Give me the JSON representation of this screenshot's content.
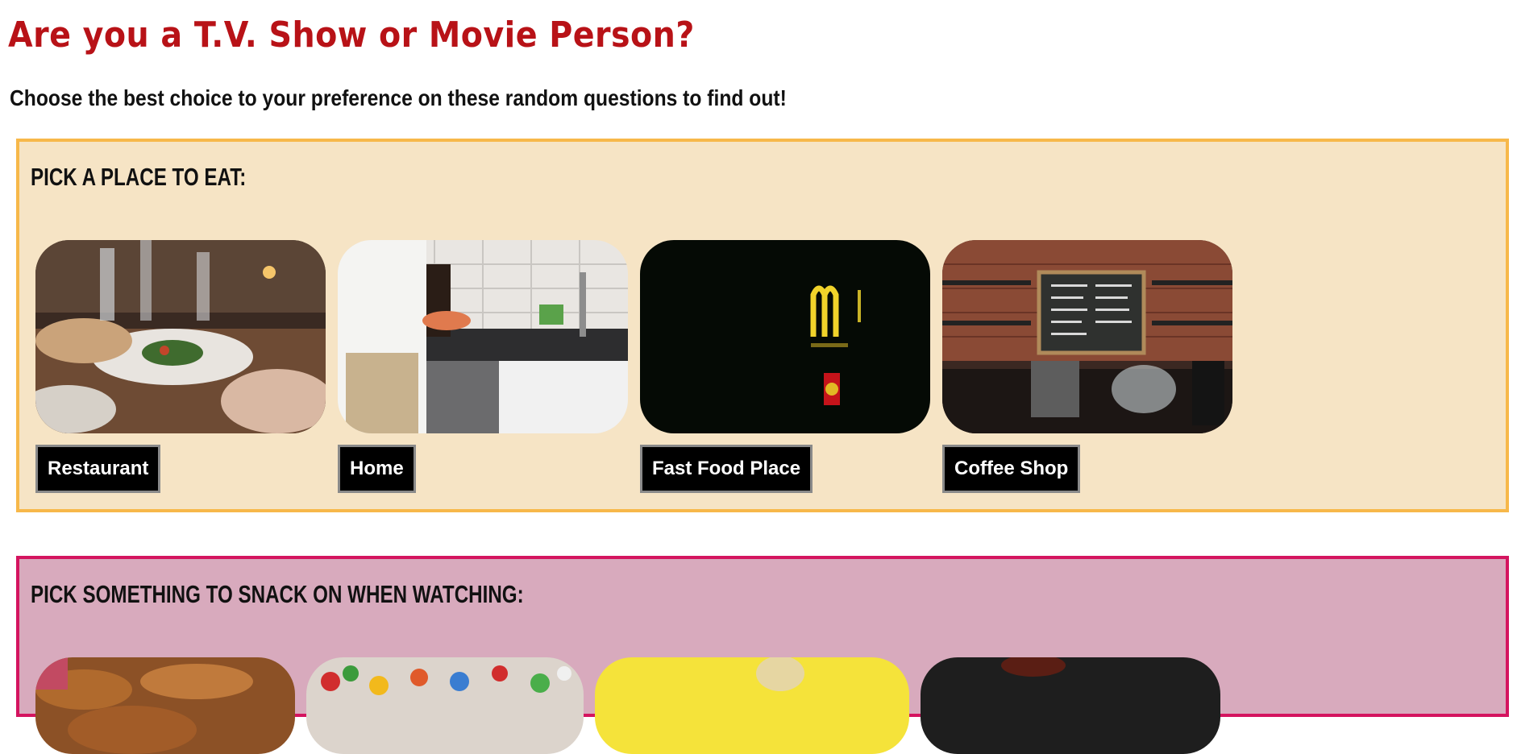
{
  "page": {
    "title": "Are you a T.V. Show or Movie Person?",
    "subtitle": "Choose the best choice to your preference on these random questions to find out!"
  },
  "colors": {
    "title": "#b81217",
    "q1_border": "#f7b84a",
    "q1_background": "#f6e4c5",
    "q2_border": "#d4145f",
    "q2_background": "#d8aabd",
    "button_background": "#000000",
    "button_text": "#ffffff"
  },
  "questions": [
    {
      "heading": "Pick a place to eat:",
      "options": [
        {
          "label": "Restaurant",
          "image": "restaurant-dining-table-photo"
        },
        {
          "label": "Home",
          "image": "home-kitchen-cooking-photo"
        },
        {
          "label": "Fast Food Place",
          "image": "mcdonalds-sign-at-night-photo"
        },
        {
          "label": "Coffee Shop",
          "image": "coffee-shop-counter-photo"
        }
      ]
    },
    {
      "heading": "Pick something to snack on when watching:",
      "options": [
        {
          "image": "pretzel-snack-photo"
        },
        {
          "image": "candy-assortment-photo"
        },
        {
          "image": "chips-on-yellow-photo"
        },
        {
          "image": "dark-snack-photo"
        }
      ]
    }
  ]
}
